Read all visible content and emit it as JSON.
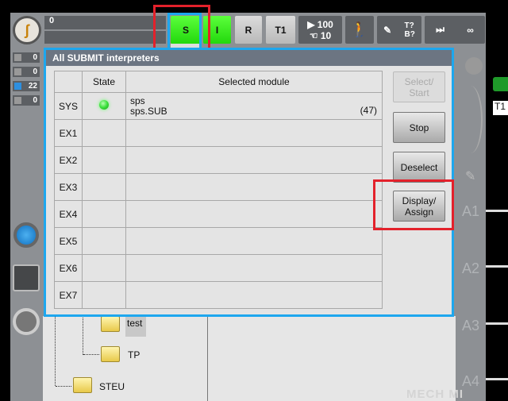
{
  "topbar": {
    "field_value": "0",
    "mode_s": "S",
    "mode_i": "I",
    "mode_r": "R",
    "mode_t1": "T1",
    "override_prog": "100",
    "override_jog": "10",
    "tool_t": "T?",
    "tool_b": "B?",
    "incremental": "∞"
  },
  "counters": [
    {
      "icon": "ack-icon",
      "value": "0"
    },
    {
      "icon": "warning-icon",
      "value": "0"
    },
    {
      "icon": "info-icon",
      "value": "22"
    },
    {
      "icon": "dialog-icon",
      "value": "0"
    }
  ],
  "dialog": {
    "title": "All SUBMIT interpreters",
    "columns": [
      "",
      "State",
      "Selected module"
    ],
    "rows": [
      {
        "name": "SYS",
        "state": "running",
        "module": "sps",
        "module2": "sps.SUB",
        "line": "(47)"
      },
      {
        "name": "EX1"
      },
      {
        "name": "EX2"
      },
      {
        "name": "EX3"
      },
      {
        "name": "EX4"
      },
      {
        "name": "EX5"
      },
      {
        "name": "EX6"
      },
      {
        "name": "EX7"
      }
    ],
    "buttons": {
      "select_start": "Select/\nStart",
      "stop": "Stop",
      "deselect": "Deselect",
      "display_assign": "Display/\nAssign"
    }
  },
  "tree": {
    "items": [
      "test",
      "TP",
      "STEU"
    ]
  },
  "axes": [
    "A1",
    "A2",
    "A3",
    "A4"
  ],
  "right": {
    "t1": "T1"
  },
  "watermark": "MECH MIND",
  "colors": {
    "highlight": "#e3212b",
    "focus": "#1ea7ee",
    "running": "#3be03b"
  }
}
